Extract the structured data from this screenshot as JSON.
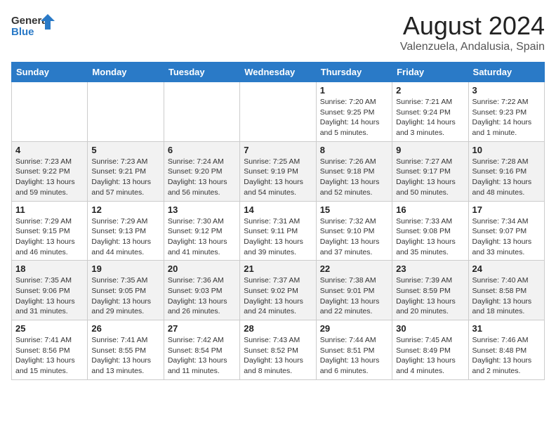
{
  "header": {
    "logo_general": "General",
    "logo_blue": "Blue",
    "title": "August 2024",
    "subtitle": "Valenzuela, Andalusia, Spain"
  },
  "weekdays": [
    "Sunday",
    "Monday",
    "Tuesday",
    "Wednesday",
    "Thursday",
    "Friday",
    "Saturday"
  ],
  "weeks": [
    [
      {
        "day": "",
        "info": ""
      },
      {
        "day": "",
        "info": ""
      },
      {
        "day": "",
        "info": ""
      },
      {
        "day": "",
        "info": ""
      },
      {
        "day": "1",
        "info": "Sunrise: 7:20 AM\nSunset: 9:25 PM\nDaylight: 14 hours\nand 5 minutes."
      },
      {
        "day": "2",
        "info": "Sunrise: 7:21 AM\nSunset: 9:24 PM\nDaylight: 14 hours\nand 3 minutes."
      },
      {
        "day": "3",
        "info": "Sunrise: 7:22 AM\nSunset: 9:23 PM\nDaylight: 14 hours\nand 1 minute."
      }
    ],
    [
      {
        "day": "4",
        "info": "Sunrise: 7:23 AM\nSunset: 9:22 PM\nDaylight: 13 hours\nand 59 minutes."
      },
      {
        "day": "5",
        "info": "Sunrise: 7:23 AM\nSunset: 9:21 PM\nDaylight: 13 hours\nand 57 minutes."
      },
      {
        "day": "6",
        "info": "Sunrise: 7:24 AM\nSunset: 9:20 PM\nDaylight: 13 hours\nand 56 minutes."
      },
      {
        "day": "7",
        "info": "Sunrise: 7:25 AM\nSunset: 9:19 PM\nDaylight: 13 hours\nand 54 minutes."
      },
      {
        "day": "8",
        "info": "Sunrise: 7:26 AM\nSunset: 9:18 PM\nDaylight: 13 hours\nand 52 minutes."
      },
      {
        "day": "9",
        "info": "Sunrise: 7:27 AM\nSunset: 9:17 PM\nDaylight: 13 hours\nand 50 minutes."
      },
      {
        "day": "10",
        "info": "Sunrise: 7:28 AM\nSunset: 9:16 PM\nDaylight: 13 hours\nand 48 minutes."
      }
    ],
    [
      {
        "day": "11",
        "info": "Sunrise: 7:29 AM\nSunset: 9:15 PM\nDaylight: 13 hours\nand 46 minutes."
      },
      {
        "day": "12",
        "info": "Sunrise: 7:29 AM\nSunset: 9:13 PM\nDaylight: 13 hours\nand 44 minutes."
      },
      {
        "day": "13",
        "info": "Sunrise: 7:30 AM\nSunset: 9:12 PM\nDaylight: 13 hours\nand 41 minutes."
      },
      {
        "day": "14",
        "info": "Sunrise: 7:31 AM\nSunset: 9:11 PM\nDaylight: 13 hours\nand 39 minutes."
      },
      {
        "day": "15",
        "info": "Sunrise: 7:32 AM\nSunset: 9:10 PM\nDaylight: 13 hours\nand 37 minutes."
      },
      {
        "day": "16",
        "info": "Sunrise: 7:33 AM\nSunset: 9:08 PM\nDaylight: 13 hours\nand 35 minutes."
      },
      {
        "day": "17",
        "info": "Sunrise: 7:34 AM\nSunset: 9:07 PM\nDaylight: 13 hours\nand 33 minutes."
      }
    ],
    [
      {
        "day": "18",
        "info": "Sunrise: 7:35 AM\nSunset: 9:06 PM\nDaylight: 13 hours\nand 31 minutes."
      },
      {
        "day": "19",
        "info": "Sunrise: 7:35 AM\nSunset: 9:05 PM\nDaylight: 13 hours\nand 29 minutes."
      },
      {
        "day": "20",
        "info": "Sunrise: 7:36 AM\nSunset: 9:03 PM\nDaylight: 13 hours\nand 26 minutes."
      },
      {
        "day": "21",
        "info": "Sunrise: 7:37 AM\nSunset: 9:02 PM\nDaylight: 13 hours\nand 24 minutes."
      },
      {
        "day": "22",
        "info": "Sunrise: 7:38 AM\nSunset: 9:01 PM\nDaylight: 13 hours\nand 22 minutes."
      },
      {
        "day": "23",
        "info": "Sunrise: 7:39 AM\nSunset: 8:59 PM\nDaylight: 13 hours\nand 20 minutes."
      },
      {
        "day": "24",
        "info": "Sunrise: 7:40 AM\nSunset: 8:58 PM\nDaylight: 13 hours\nand 18 minutes."
      }
    ],
    [
      {
        "day": "25",
        "info": "Sunrise: 7:41 AM\nSunset: 8:56 PM\nDaylight: 13 hours\nand 15 minutes."
      },
      {
        "day": "26",
        "info": "Sunrise: 7:41 AM\nSunset: 8:55 PM\nDaylight: 13 hours\nand 13 minutes."
      },
      {
        "day": "27",
        "info": "Sunrise: 7:42 AM\nSunset: 8:54 PM\nDaylight: 13 hours\nand 11 minutes."
      },
      {
        "day": "28",
        "info": "Sunrise: 7:43 AM\nSunset: 8:52 PM\nDaylight: 13 hours\nand 8 minutes."
      },
      {
        "day": "29",
        "info": "Sunrise: 7:44 AM\nSunset: 8:51 PM\nDaylight: 13 hours\nand 6 minutes."
      },
      {
        "day": "30",
        "info": "Sunrise: 7:45 AM\nSunset: 8:49 PM\nDaylight: 13 hours\nand 4 minutes."
      },
      {
        "day": "31",
        "info": "Sunrise: 7:46 AM\nSunset: 8:48 PM\nDaylight: 13 hours\nand 2 minutes."
      }
    ]
  ]
}
